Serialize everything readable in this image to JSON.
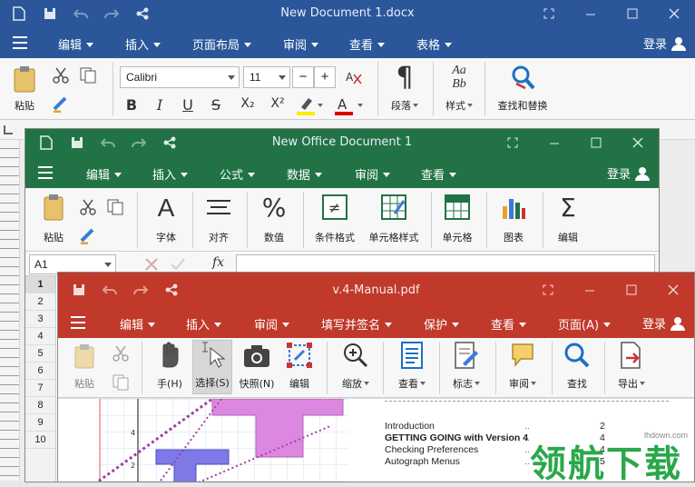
{
  "word": {
    "title": "New Document 1.docx",
    "color": "#2b579a",
    "menu": [
      "编辑",
      "插入",
      "页面布局",
      "审阅",
      "查看",
      "表格"
    ],
    "login": "登录",
    "ribbon": {
      "paste": "粘贴",
      "font_name": "Calibri",
      "font_size": "11",
      "minus": "−",
      "plus": "+",
      "para": "段落",
      "style": "样式",
      "style_glyph": "Aa\nBb",
      "find": "查找和替换",
      "bold": "B",
      "italic": "I",
      "underline": "U",
      "strike": "S",
      "sub": "X₂",
      "sup": "X²"
    }
  },
  "sheet": {
    "title": "New Office Document 1",
    "color": "#217346",
    "menu": [
      "编辑",
      "插入",
      "公式",
      "数据",
      "审阅",
      "查看"
    ],
    "login": "登录",
    "ribbon": {
      "paste": "粘贴",
      "font": "字体",
      "align": "对齐",
      "number": "数值",
      "cond": "条件格式",
      "cellfmt": "单元格样式",
      "cell": "单元格",
      "chart": "图表",
      "edit": "编辑"
    },
    "cellref": "A1",
    "fx": "fx",
    "rows": [
      "1",
      "2",
      "3",
      "4",
      "5",
      "6",
      "7",
      "8",
      "9",
      "10"
    ]
  },
  "pdf": {
    "title": "v.4-Manual.pdf",
    "color": "#c0392b",
    "menu": [
      "编辑",
      "插入",
      "审阅",
      "填写并签名",
      "保护",
      "查看",
      "页面(A)"
    ],
    "login": "登录",
    "ribbon": {
      "paste": "粘贴",
      "hand": "手(H)",
      "select": "选择(S)",
      "snapshot": "快照(N)",
      "edit": "编辑",
      "zoom": "缩放",
      "view": "查看",
      "mark": "标志",
      "review": "审阅",
      "find": "查找",
      "export": "导出"
    },
    "toc": [
      {
        "t": "Introduction",
        "p": "2",
        "b": false
      },
      {
        "t": "GETTING GOING with Version 4",
        "p": "4",
        "b": true
      },
      {
        "t": "Checking Preferences",
        "p": "4",
        "b": false
      },
      {
        "t": "Autograph Menus",
        "p": "5",
        "b": false
      }
    ],
    "axis": [
      "4",
      "2"
    ]
  },
  "watermark": {
    "text": "领航下载",
    "url": "lhdown.com"
  }
}
